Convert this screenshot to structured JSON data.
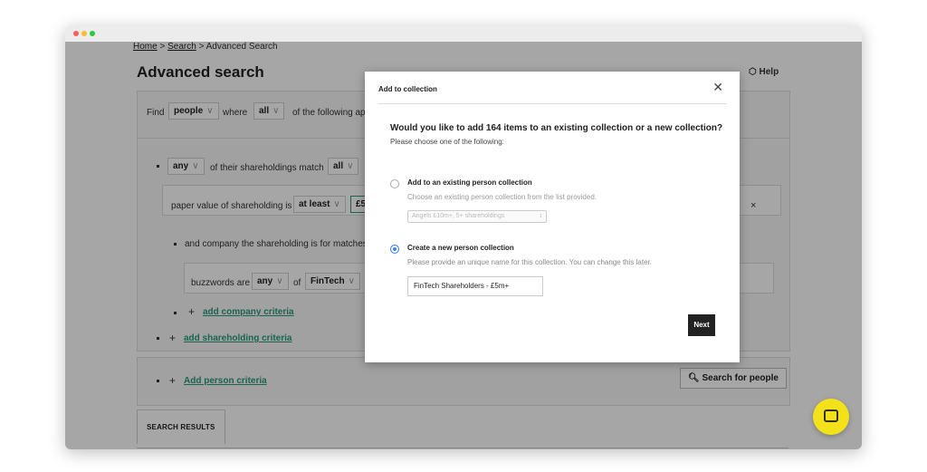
{
  "breadcrumb": {
    "home": "Home",
    "sep1": ">",
    "search": "Search",
    "sep2": ">",
    "current": "Advanced Search"
  },
  "page_title": "Advanced search",
  "help_label": "Help",
  "find_row": {
    "find": "Find",
    "entity": "people",
    "where": "where",
    "all": "all",
    "rest": "of the following ap"
  },
  "shareholding_row": {
    "any": "any",
    "text": "of their shareholdings match",
    "all": "all"
  },
  "value_row": {
    "label": "paper value of shareholding is",
    "op": "at least",
    "amount": "£5"
  },
  "company_row": {
    "text": "and  company the shareholding is for matches"
  },
  "buzzwords_row": {
    "label": "buzzwords are",
    "any": "any",
    "of": "of",
    "value": "FinTech"
  },
  "links": {
    "add_company": "add company criteria",
    "add_shareholding": "add shareholding criteria",
    "add_person": "Add person criteria"
  },
  "search_button": "Search for people",
  "tab_results": "SEARCH RESULTS",
  "modal": {
    "title": "Add to collection",
    "question": "Would you like to add 164 items to an existing collection or a new collection?",
    "subtitle": "Please choose one of the following:",
    "existing_label": "Add to an existing person collection",
    "existing_desc": "Choose an existing person collection from the list provided.",
    "existing_select": "Angels £10m+, 5+ shareholdings",
    "new_label": "Create a new person collection",
    "new_desc": "Please provide an unique name for this collection. You can change this later.",
    "new_value": "FinTech Shareholders - £5m+",
    "next": "Next",
    "selected": "new"
  },
  "icons": {
    "close": "close-icon",
    "help": "help-icon",
    "search": "search-icon",
    "chat": "chat-icon",
    "chevron": "chevron-down-icon"
  }
}
